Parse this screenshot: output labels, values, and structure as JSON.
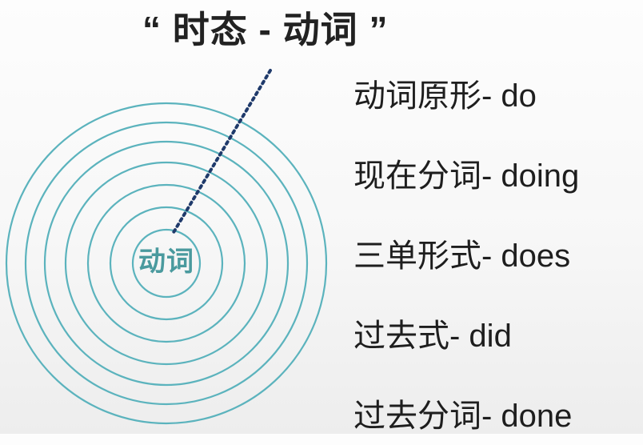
{
  "title": "“ 时态 - 动词 ”",
  "center_label": "动词",
  "ring_color": "#5bb3bd",
  "leader_color": "#1f3a6b",
  "ring_count": 7,
  "verb_forms": [
    {
      "text": "动词原形- do"
    },
    {
      "text": "现在分词- doing"
    },
    {
      "text": "三单形式- does"
    },
    {
      "text": "过去式- did"
    },
    {
      "text": "过去分词- done"
    }
  ]
}
